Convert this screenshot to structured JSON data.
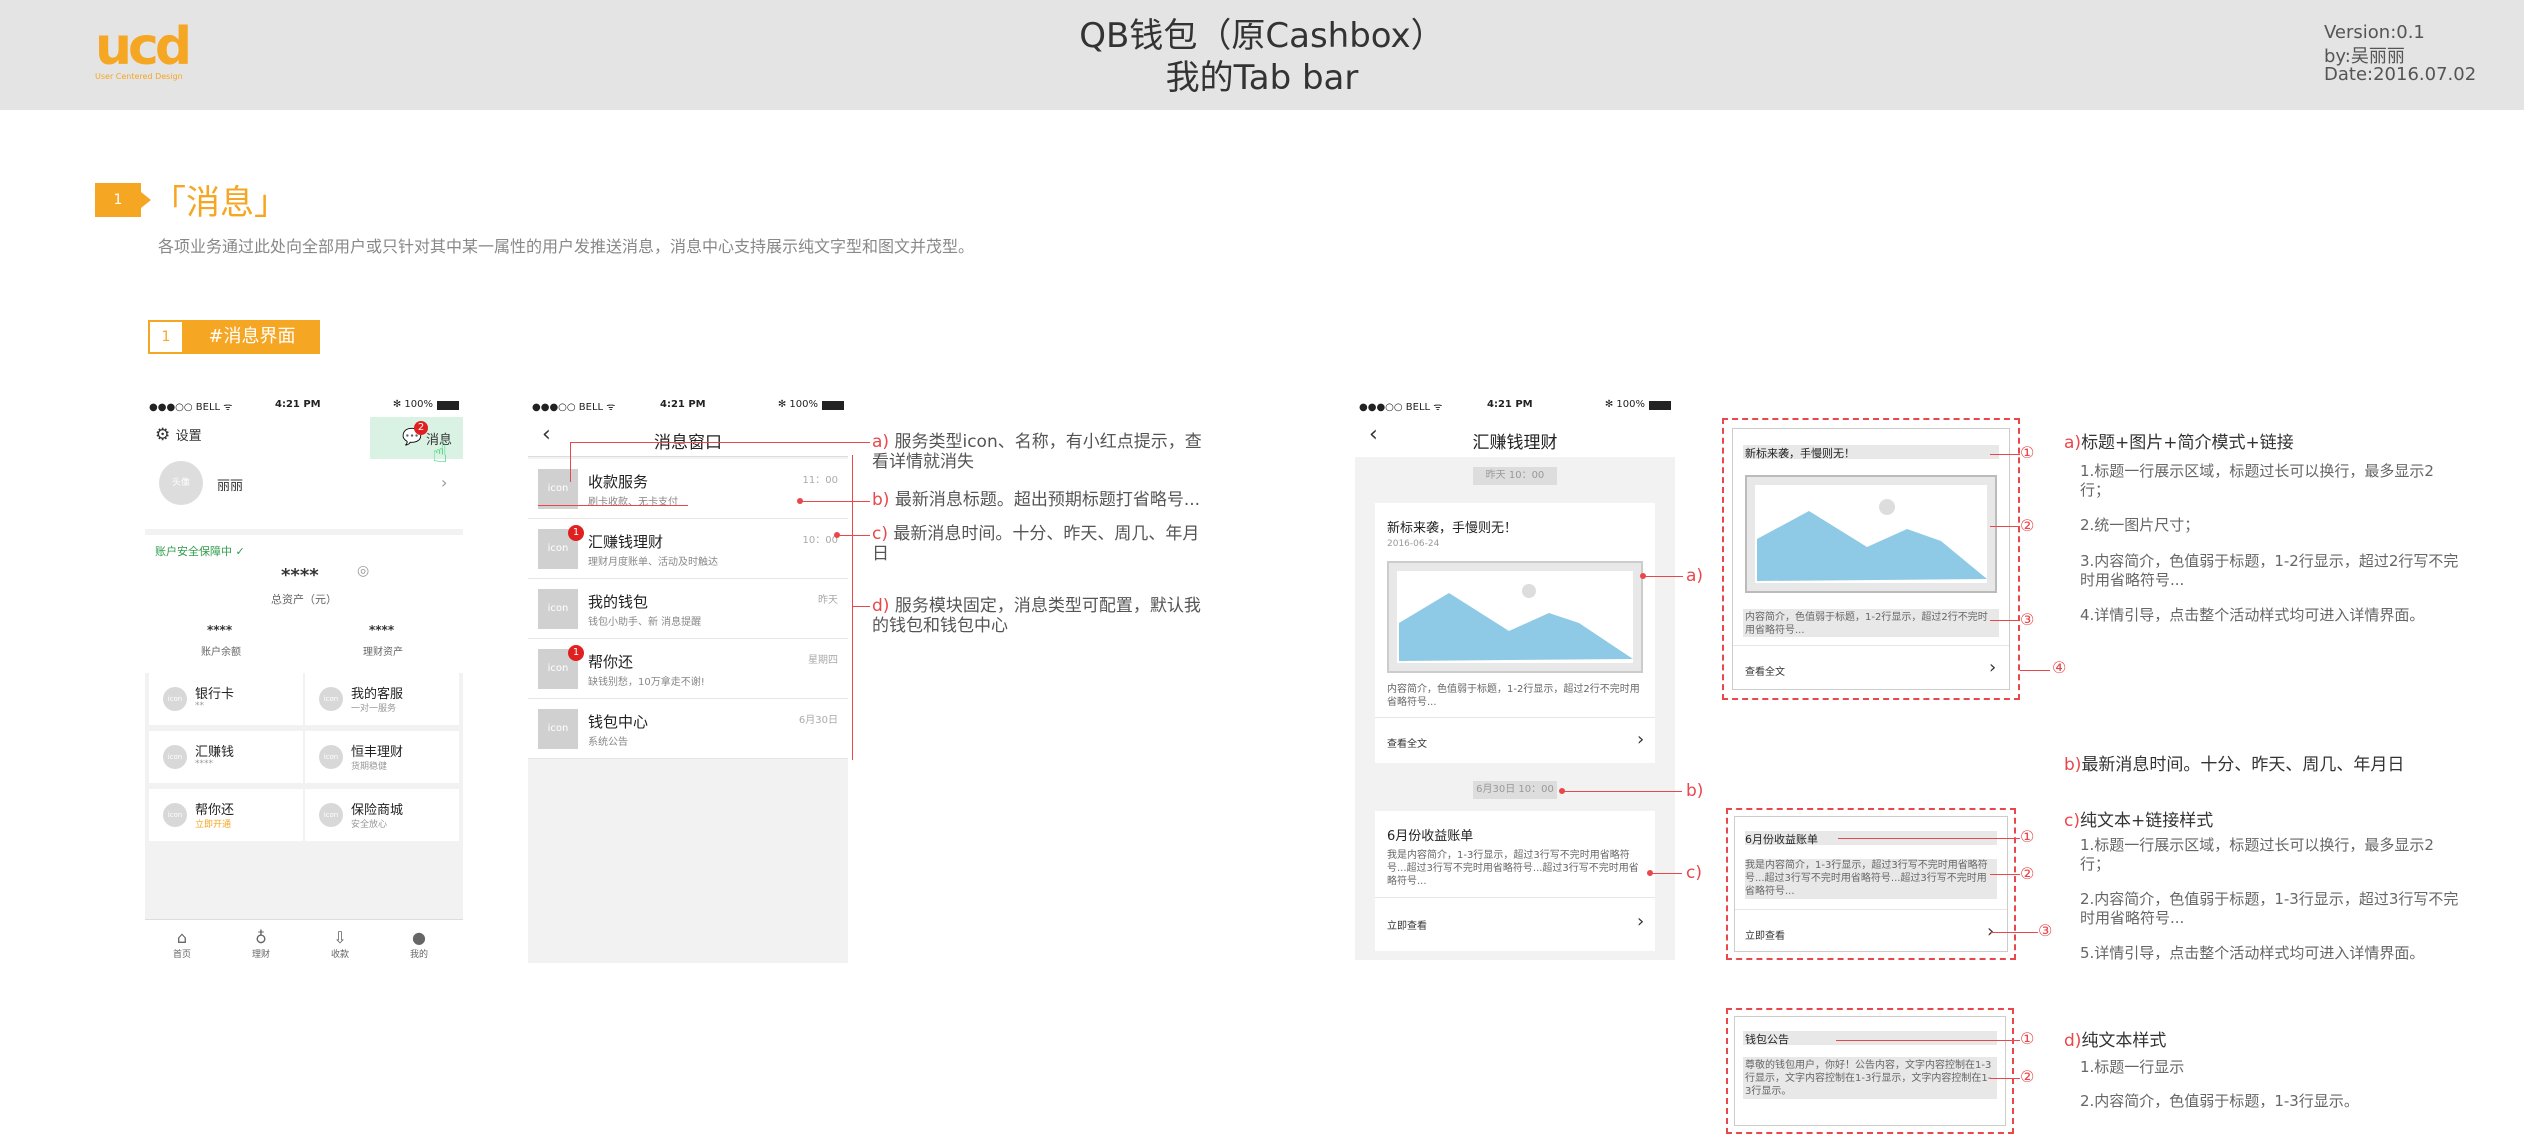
{
  "header": {
    "logo_text": "ucd",
    "logo_sub": "User Centered Design",
    "title1": "QB钱包（原Cashbox）",
    "title2": "我的Tab bar",
    "version": "Version:0.1",
    "by": "by:吴丽丽",
    "date": "Date:2016.07.02"
  },
  "section": {
    "num": "1",
    "title": "「消息」",
    "desc": "各项业务通过此处向全部用户或只针对其中某一属性的用户发推送消息，消息中心支持展示纯文字型和图文并茂型。",
    "sub_num": "1",
    "sub_label": "#消息界面"
  },
  "status": {
    "carrier": "●●●○○ BELL ᯤ",
    "time": "4:21 PM",
    "battery": "✻ 100%"
  },
  "phone1": {
    "settings": "设置",
    "msg": "消息",
    "msg_badge": "2",
    "avatar": "头像",
    "name": "丽丽",
    "security": "账户安全保障中",
    "stars": "****",
    "total_label": "总资产（元）",
    "balance_val": "****",
    "balance_label": "账户余额",
    "finance_val": "****",
    "finance_label": "理财资产",
    "grid": [
      {
        "icon": "icon",
        "title": "银行卡",
        "sub": "**"
      },
      {
        "icon": "icon",
        "title": "我的客服",
        "sub": "一对一服务"
      },
      {
        "icon": "icon",
        "title": "汇赚钱",
        "sub": "****"
      },
      {
        "icon": "icon",
        "title": "恒丰理财",
        "sub": "货期稳健"
      },
      {
        "icon": "icon",
        "title": "帮你还",
        "sub": "立即开通"
      },
      {
        "icon": "icon",
        "title": "保险商城",
        "sub": "安全放心"
      }
    ],
    "tabs": [
      "首页",
      "理财",
      "收款",
      "我的"
    ]
  },
  "phone2": {
    "title": "消息窗口",
    "rows": [
      {
        "icon": "icon",
        "title": "收款服务",
        "sub": "刷卡收款、无卡支付",
        "time": "11：00",
        "badge": ""
      },
      {
        "icon": "icon",
        "title": "汇赚钱理财",
        "sub": "理财月度账单、活动及时触达",
        "time": "10：00",
        "badge": "1"
      },
      {
        "icon": "icon",
        "title": "我的钱包",
        "sub": "钱包小助手、新 消息提醒",
        "time": "昨天",
        "badge": ""
      },
      {
        "icon": "icon",
        "title": "帮你还",
        "sub": "缺钱别愁，10万拿走不谢!",
        "time": "星期四",
        "badge": "1"
      },
      {
        "icon": "icon",
        "title": "钱包中心",
        "sub": "系统公告",
        "time": "6月30日",
        "badge": ""
      }
    ]
  },
  "annotations2": [
    {
      "tag": "a)",
      "text": "服务类型icon、名称，有小红点提示，查看详情就消失"
    },
    {
      "tag": "b)",
      "text": "最新消息标题。超出预期标题打省略号..."
    },
    {
      "tag": "c)",
      "text": "最新消息时间。十分、昨天、周几、年月日"
    },
    {
      "tag": "d)",
      "text": "服务模块固定，消息类型可配置，默认我的钱包和钱包中心"
    }
  ],
  "phone3": {
    "title": "汇赚钱理财",
    "time1": "昨天 10：00",
    "card1_title": "新标来袭，手慢则无！",
    "card1_date": "2016-06-24",
    "card1_desc": "内容简介，色值弱于标题，1-2行显示，超过2行不完时用省略符号...",
    "card1_link": "查看全文",
    "time2": "6月30日 10：00",
    "card2_title": "6月份收益账单",
    "card2_desc": "我是内容简介，1-3行显示，超过3行写不完时用省略符号...超过3行写不完时用省略符号...超过3行写不完时用省略符号...",
    "card2_link": "立即查看",
    "tags": [
      "a)",
      "b)",
      "c)"
    ]
  },
  "spec": {
    "a_box_title": "新标来袭，手慢则无！",
    "a_box_desc": "内容简介，色值弱于标题，1-2行显示，超过2行不完时用省略符号...",
    "a_box_link": "查看全文",
    "c_box_title": "6月份收益账单",
    "c_box_desc": "我是内容简介，1-3行显示，超过3行写不完时用省略符号...超过3行写不完时用省略符号...超过3行写不完时用省略符号...",
    "c_box_link": "立即查看",
    "d_box_title": "钱包公告",
    "d_box_desc": "尊敬的钱包用户，你好！公告内容，文字内容控制在1-3行显示，文字内容控制在1-3行显示，文字内容控制在1-3行显示。",
    "circles": [
      "①",
      "②",
      "③",
      "④"
    ]
  },
  "desc": {
    "a_tag": "a)",
    "a_title": "标题+图片+简介模式+链接",
    "a_items": [
      "1.标题一行展示区域，标题过长可以换行，最多显示2行；",
      "2.统一图片尺寸；",
      "3.内容简介，色值弱于标题，1-2行显示，超过2行写不完时用省略符号...",
      "4.详情引导，点击整个活动样式均可进入详情界面。"
    ],
    "b_tag": "b)",
    "b_title": "最新消息时间。十分、昨天、周几、年月日",
    "c_tag": "c)",
    "c_title": "纯文本+链接样式",
    "c_items": [
      "1.标题一行展示区域，标题过长可以换行，最多显示2行；",
      "2.内容简介，色值弱于标题，1-3行显示，超过3行写不完时用省略符号...",
      "5.详情引导，点击整个活动样式均可进入详情界面。"
    ],
    "d_tag": "d)",
    "d_title": "纯文本样式",
    "d_items": [
      "1.标题一行显示",
      "2.内容简介，色值弱于标题，1-3行显示。"
    ]
  },
  "colors": {
    "accent": "#f5a623",
    "annotation": "#e8474c",
    "image_fill": "#8ecae6"
  }
}
